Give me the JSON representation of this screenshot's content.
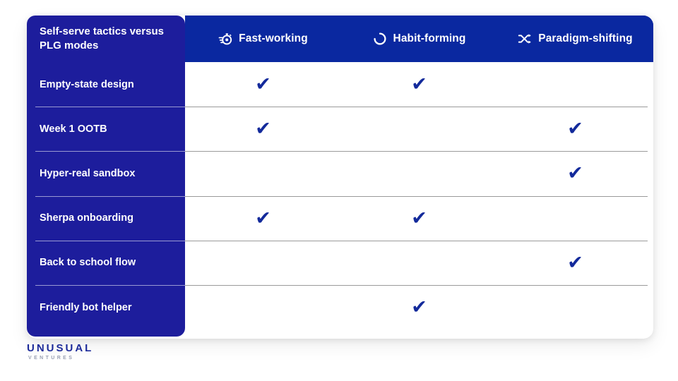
{
  "card": {
    "sidebar_title": "Self-serve tactics versus PLG modes",
    "columns": [
      {
        "label": "Fast-working",
        "icon": "stopwatch-speed-icon"
      },
      {
        "label": "Habit-forming",
        "icon": "refresh-cycle-icon"
      },
      {
        "label": "Paradigm-shifting",
        "icon": "shuffle-icon"
      }
    ],
    "rows": [
      {
        "label": "Empty-state design",
        "marks": [
          true,
          true,
          false
        ]
      },
      {
        "label": "Week 1 OOTB",
        "marks": [
          true,
          false,
          true
        ]
      },
      {
        "label": "Hyper-real sandbox",
        "marks": [
          false,
          false,
          true
        ]
      },
      {
        "label": "Sherpa onboarding",
        "marks": [
          true,
          true,
          false
        ]
      },
      {
        "label": "Back to school flow",
        "marks": [
          false,
          false,
          true
        ]
      },
      {
        "label": "Friendly bot helper",
        "marks": [
          false,
          true,
          false
        ]
      }
    ],
    "check_glyph": "✔"
  },
  "logo": {
    "name": "UNUSUAL",
    "tagline": "VENTURES"
  },
  "colors": {
    "sidebar_blue": "#1d1d9c",
    "header_blue": "#0a28a0",
    "check_blue": "#132a9b",
    "logo_blue": "#1d2b9a",
    "rule_gray": "#9a9a9a"
  }
}
